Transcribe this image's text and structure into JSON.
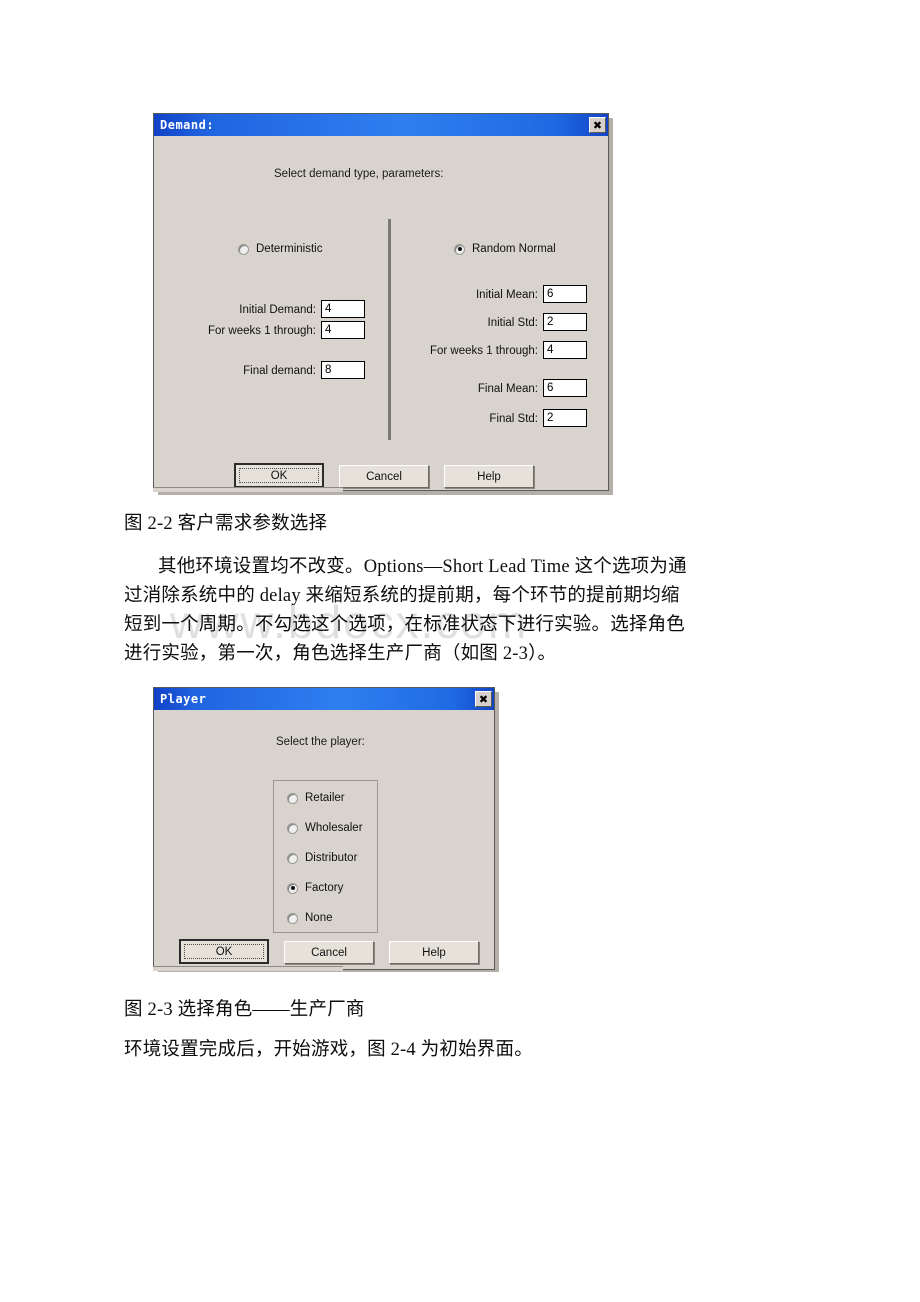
{
  "page": {
    "watermark": "www.bdocx.com"
  },
  "demand_dialog": {
    "title": "Demand:",
    "close_label": "✖",
    "hint": "Select demand type, parameters:",
    "left": {
      "radio_label": "Deterministic",
      "radio_checked": false,
      "fields": [
        {
          "label": "Initial Demand:",
          "value": "4"
        },
        {
          "label": "For weeks 1 through:",
          "value": "4"
        },
        {
          "label": "Final demand:",
          "value": "8"
        }
      ]
    },
    "right": {
      "radio_label": "Random Normal",
      "radio_checked": true,
      "fields": [
        {
          "label": "Initial Mean:",
          "value": "6"
        },
        {
          "label": "Initial Std:",
          "value": "2"
        },
        {
          "label": "For weeks 1 through:",
          "value": "4"
        },
        {
          "label": "Final Mean:",
          "value": "6"
        },
        {
          "label": "Final Std:",
          "value": "2"
        }
      ]
    },
    "buttons": {
      "ok": "OK",
      "cancel": "Cancel",
      "help": "Help"
    }
  },
  "figure_caption_2_2": "图 2-2 客户需求参数选择",
  "paragraph_1": [
    "其他环境设置均不改变。Options—Short Lead Time 这个选项为通",
    "过消除系统中的 delay 来缩短系统的提前期，每个环节的提前期均缩",
    "短到一个周期。不勾选这个选项，在标准状态下进行实验。选择角色",
    "进行实验，第一次，角色选择生产厂商（如图 2-3）。"
  ],
  "player_dialog": {
    "title": "Player",
    "close_label": "✖",
    "hint": "Select the player:",
    "options": [
      {
        "label": "Retailer",
        "checked": false
      },
      {
        "label": "Wholesaler",
        "checked": false
      },
      {
        "label": "Distributor",
        "checked": false
      },
      {
        "label": "Factory",
        "checked": true
      },
      {
        "label": "None",
        "checked": false
      }
    ],
    "buttons": {
      "ok": "OK",
      "cancel": "Cancel",
      "help": "Help"
    }
  },
  "figure_caption_2_3": "图 2-3 选择角色——生产厂商",
  "paragraph_2": "环境设置完成后，开始游戏，图 2-4 为初始界面。"
}
